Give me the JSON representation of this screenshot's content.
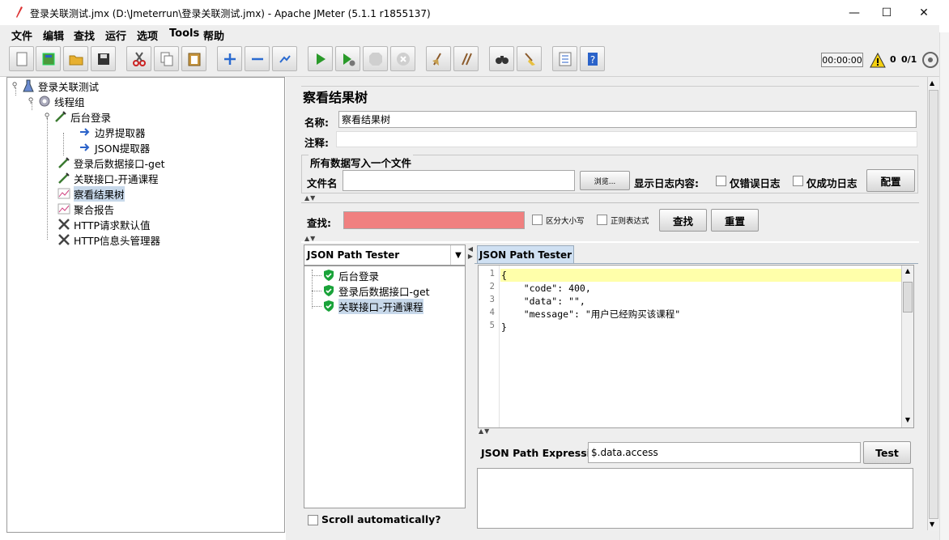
{
  "window": {
    "title": "登录关联测试.jmx (D:\\Jmeterrun\\登录关联测试.jmx) - Apache JMeter (5.1.1 r1855137)",
    "minimize": "—",
    "maximize": "☐",
    "close": "✕"
  },
  "menu": [
    "文件",
    "编辑",
    "查找",
    "运行",
    "选项",
    "Tools",
    "帮助"
  ],
  "toolbar": {
    "timer": "00:00:00",
    "warning_count": "0",
    "thread_ratio": "0/1"
  },
  "tree": [
    {
      "label": "登录关联测试",
      "icon": "test-plan-icon"
    },
    {
      "label": "线程组",
      "icon": "thread-group-icon"
    },
    {
      "label": "后台登录",
      "icon": "sampler-icon"
    },
    {
      "label": "边界提取器",
      "icon": "extractor-icon"
    },
    {
      "label": "JSON提取器",
      "icon": "extractor-icon"
    },
    {
      "label": "登录后数据接口-get",
      "icon": "sampler-icon"
    },
    {
      "label": "关联接口-开通课程",
      "icon": "sampler-icon"
    },
    {
      "label": "察看结果树",
      "icon": "listener-icon"
    },
    {
      "label": "聚合报告",
      "icon": "listener-icon"
    },
    {
      "label": "HTTP请求默认值",
      "icon": "config-icon"
    },
    {
      "label": "HTTP信息头管理器",
      "icon": "config-icon"
    }
  ],
  "panel": {
    "heading": "察看结果树",
    "name_label": "名称:",
    "name_value": "察看结果树",
    "comment_label": "注释:",
    "comment_value": "",
    "file_section": "所有数据写入一个文件",
    "filename_label": "文件名",
    "filename_value": "",
    "browse_button": "浏览...",
    "log_label": "显示日志内容:",
    "errors_only": "仅错误日志",
    "success_only": "仅成功日志",
    "config_button": "配置",
    "search_label": "查找:",
    "search_value": "",
    "case_sensitive": "区分大小写",
    "regex": "正则表达式",
    "find_button": "查找",
    "reset_button": "重置"
  },
  "results": {
    "renderer": "JSON Path Tester",
    "items": [
      "后台登录",
      "登录后数据接口-get",
      "关联接口-开通课程"
    ],
    "scroll_auto": "Scroll automatically?"
  },
  "tester": {
    "tab_label": "JSON Path Tester",
    "code_lines": [
      "{",
      "    \"code\": 400,",
      "    \"data\": \"\",",
      "    \"message\": \"用户已经购买该课程\"",
      "}"
    ],
    "line_numbers": [
      "1",
      "2",
      "3",
      "4",
      "5"
    ],
    "expr_label": "JSON Path Expression",
    "expr_value": "$.data.access",
    "test_button": "Test"
  },
  "colors": {
    "search_field": "#f08080",
    "code_highlight": "#ffffaa",
    "selected": "#c7d8ea",
    "success": "#1aa33a"
  }
}
